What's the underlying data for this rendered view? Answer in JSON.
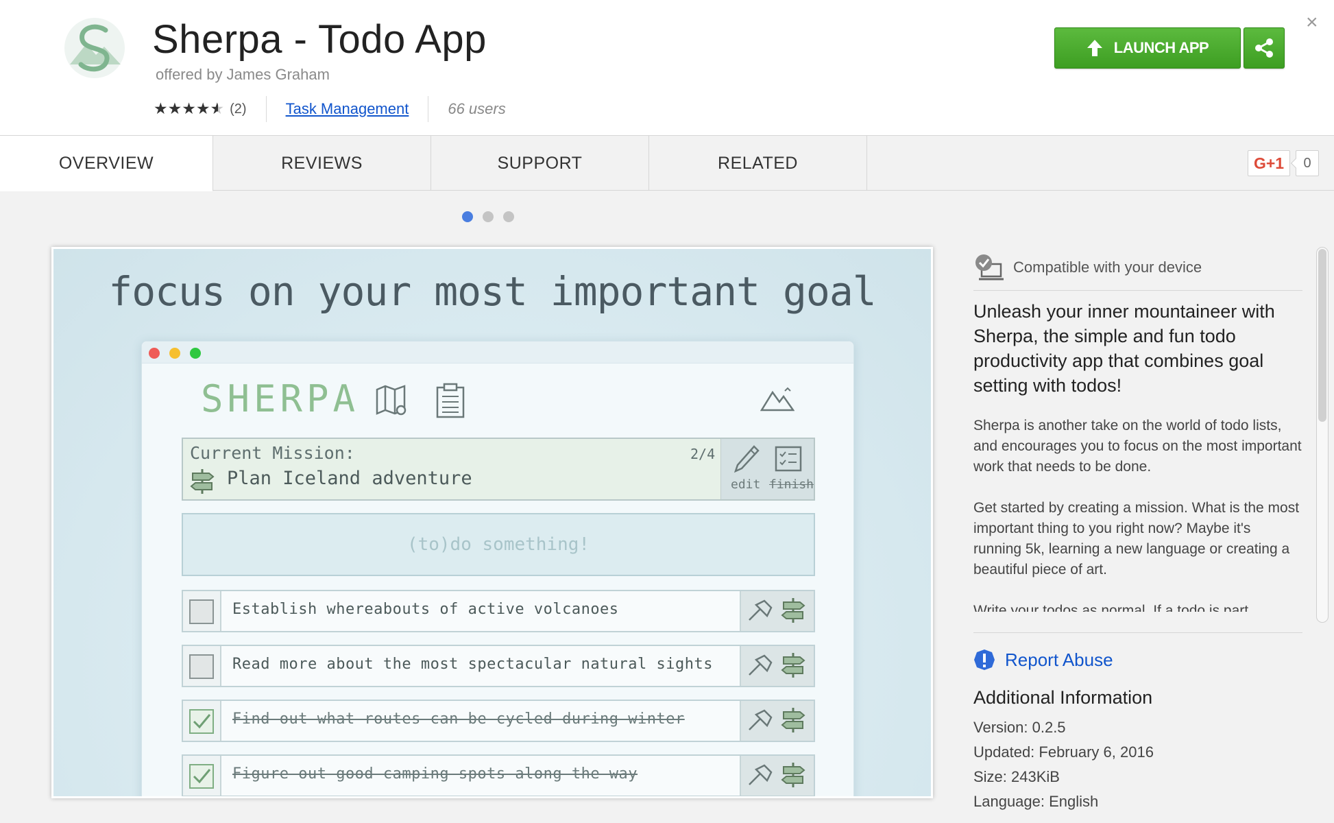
{
  "header": {
    "title": "Sherpa - Todo App",
    "offered_by": "offered by James Graham",
    "rating_count": "(2)",
    "rating_value": 4.5,
    "category": "Task Management",
    "users": "66 users",
    "launch_label": "LAUNCH APP",
    "close_label": "×"
  },
  "tabs": [
    "OVERVIEW",
    "REVIEWS",
    "SUPPORT",
    "RELATED"
  ],
  "gplus": {
    "label": "G+1",
    "count": "0"
  },
  "carousel": {
    "count": 3,
    "active": 0
  },
  "screenshot": {
    "headline": "focus on your most important goal",
    "logo_text": "SHERPA",
    "mission_label": "Current Mission:",
    "mission_text": "Plan Iceland adventure",
    "mission_count": "2/4",
    "edit_label": "edit",
    "finish_label": "finish",
    "todo_placeholder": "(to)do something!",
    "todos": [
      {
        "text": "Establish whereabouts of active volcanoes",
        "done": false
      },
      {
        "text": "Read more about the most spectacular natural sights",
        "done": false
      },
      {
        "text": "Find out what routes can be cycled during winter",
        "done": true
      },
      {
        "text": "Figure out good camping spots along the way",
        "done": true
      }
    ]
  },
  "sidebar": {
    "compatible": "Compatible with your device",
    "lead": "Unleash your inner mountaineer with Sherpa, the simple and fun todo productivity app that combines goal setting with todos!",
    "paragraphs": [
      "Sherpa is another take on the world of todo lists, and encourages you to focus on the most important work that needs to be done.",
      "Get started by creating a mission. What is the most important thing to you right now? Maybe it's running 5k, learning a new language or creating a beautiful piece of art.",
      "Write your todos as normal. If a todo is part"
    ],
    "report_abuse": "Report Abuse",
    "additional_title": "Additional Information",
    "version": "Version: 0.2.5",
    "updated": "Updated: February 6, 2016",
    "size": "Size: 243KiB",
    "language": "Language: English"
  },
  "colors": {
    "launch_green": "#4cae2f",
    "link_blue": "#1155cc",
    "active_dot": "#4a7ee0",
    "report_icon": "#2f6ad8"
  },
  "icons": [
    "app-logo-icon",
    "star-icon",
    "upload-arrow-icon",
    "share-icon",
    "close-icon",
    "map-icon",
    "clipboard-icon",
    "mountain-icon",
    "signpost-icon",
    "pencil-icon",
    "checklist-icon",
    "hammer-icon",
    "device-check-icon",
    "alert-icon"
  ]
}
